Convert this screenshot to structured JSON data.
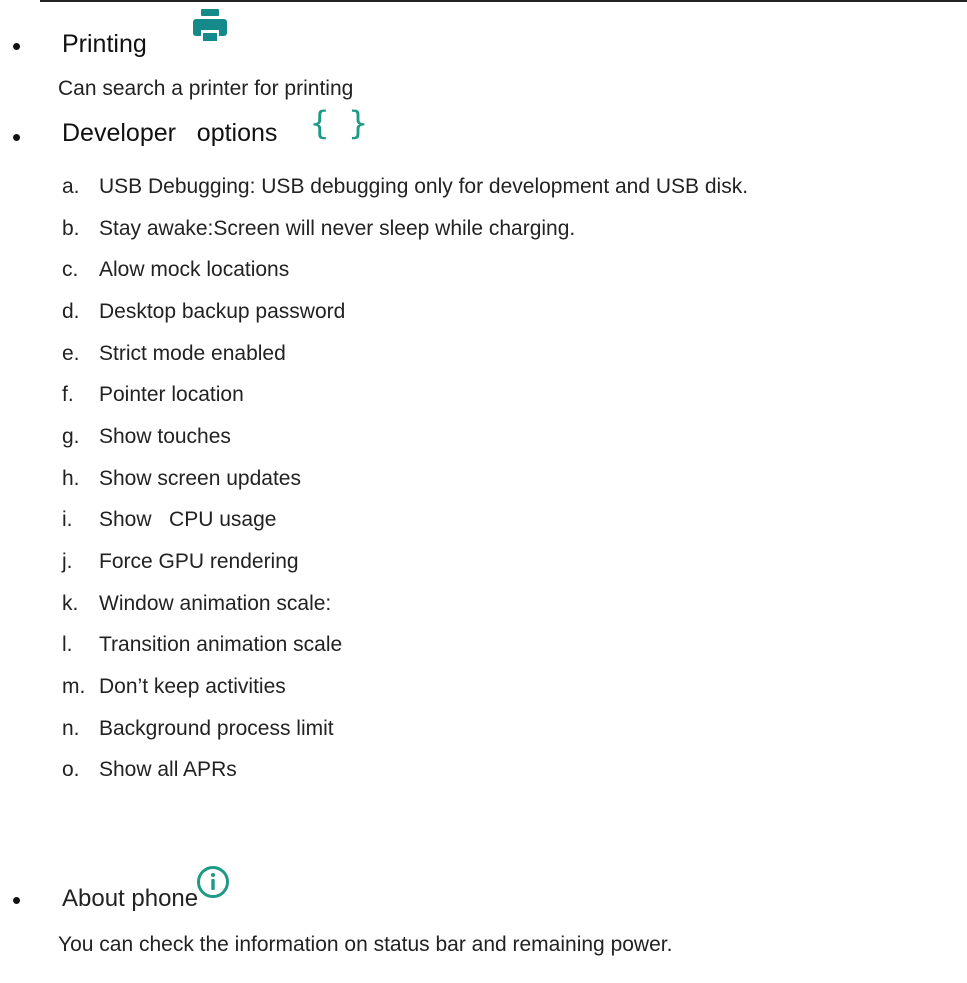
{
  "sections": {
    "printing": {
      "bullet": "•",
      "title": "Printing",
      "icon": "printer-icon",
      "icon_color": "#148a8a",
      "description": "Can search a printer for printing"
    },
    "developer": {
      "bullet": "•",
      "title": "Developer   options",
      "icon": "braces-icon",
      "icon_glyph": "{ }",
      "icon_color": "#1e9a86",
      "items": [
        {
          "marker": "a.",
          "text": "USB Debugging: USB debugging only for development and USB disk."
        },
        {
          "marker": "b.",
          "text": "Stay awake:Screen will never sleep while charging."
        },
        {
          "marker": "c.",
          "text": "Alow mock locations"
        },
        {
          "marker": "d.",
          "text": "Desktop backup password"
        },
        {
          "marker": "e.",
          "text": "Strict mode enabled"
        },
        {
          "marker": "f.",
          "text": "Pointer location"
        },
        {
          "marker": "g.",
          "text": "Show touches"
        },
        {
          "marker": "h.",
          "text": "Show screen updates"
        },
        {
          "marker": "i.",
          "text": "Show   CPU usage"
        },
        {
          "marker": "j.",
          "text": "Force GPU rendering"
        },
        {
          "marker": "k.",
          "text": "Window animation scale:"
        },
        {
          "marker": "l.",
          "text": "Transition animation scale"
        },
        {
          "marker": "m.",
          "text": "Don’t keep activities"
        },
        {
          "marker": "n.",
          "text": "Background process limit"
        },
        {
          "marker": "o.",
          "text": "Show all APRs"
        }
      ]
    },
    "about": {
      "bullet": "•",
      "title": "About phone",
      "icon": "info-icon",
      "icon_color": "#1e9a86",
      "description": "You can check the information on status bar and remaining power."
    }
  }
}
